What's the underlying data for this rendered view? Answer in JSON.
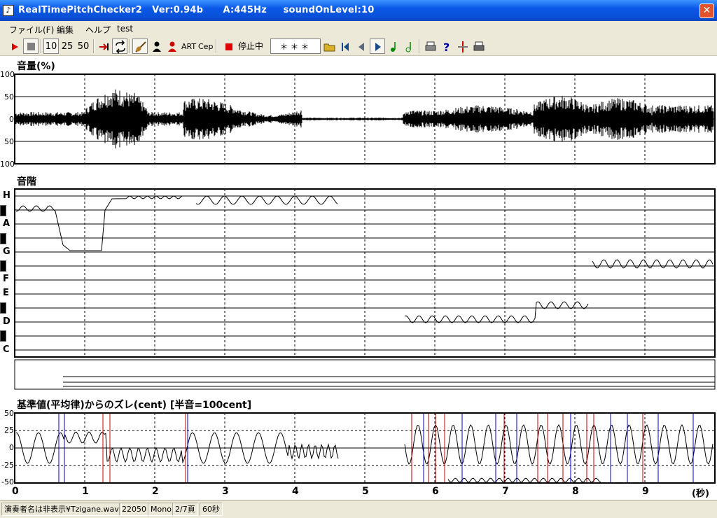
{
  "window": {
    "title": "RealTimePitchChecker2   Ver:0.94b      A:445Hz     soundOnLevel:10",
    "close_glyph": "✕"
  },
  "menu": [
    "ファイル(F)",
    "編集",
    "ヘルプ",
    "test"
  ],
  "toolbar": {
    "speed_10": "10",
    "speed_25": "25",
    "speed_50": "50",
    "art_label": "ART",
    "cep_label": "Cep",
    "status_text": "停止中",
    "note_display": "＊＊＊"
  },
  "panels": {
    "volume": {
      "title": "音量(%)",
      "y_labels": [
        "100",
        "50",
        "0",
        "50",
        "100"
      ]
    },
    "pitch": {
      "title": "音階",
      "notes": [
        "H",
        "A",
        "G",
        "F",
        "E",
        "D",
        "C"
      ]
    },
    "deviation": {
      "title": "基準値(平均律)からのズレ(cent) [半音=100cent]",
      "y_labels": [
        "50",
        "25",
        "0",
        "-25",
        "-50"
      ]
    }
  },
  "x_axis": {
    "labels": [
      "0",
      "1",
      "2",
      "3",
      "4",
      "5",
      "6",
      "7",
      "8",
      "9"
    ],
    "unit": "(秒)"
  },
  "status": {
    "file": "演奏者名は非表示¥Tzigane.wav",
    "sample_rate": "22050",
    "channels": "Mono",
    "page": "2/7頁",
    "length": "60秒"
  },
  "colors": {
    "titlebar": "#0a58e6",
    "chrome": "#ece9d8",
    "deviation_red": "#c00000",
    "deviation_blue": "#0000c0"
  }
}
